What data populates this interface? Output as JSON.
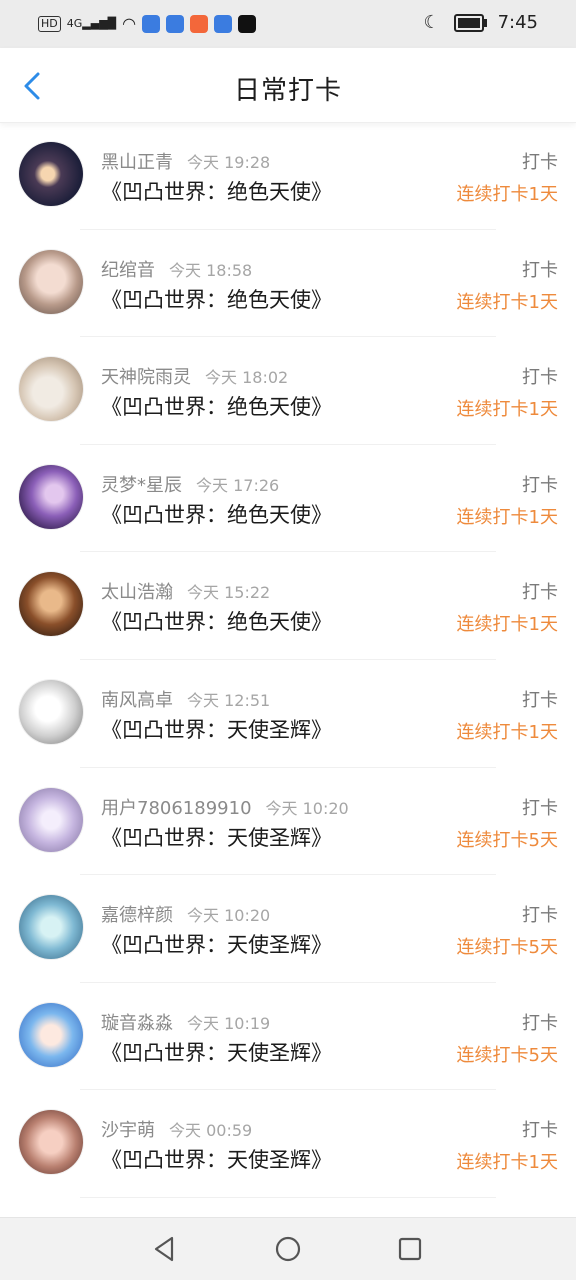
{
  "status_bar": {
    "time": "7:45",
    "left_icons": [
      "hd-icon",
      "signal-4g-icon",
      "wifi-icon",
      "app-paw-icon",
      "app-paw-icon",
      "app-orange-icon",
      "app-paw-icon",
      "app-bird-icon"
    ],
    "right_icons": [
      "moon-icon",
      "battery-icon"
    ]
  },
  "header": {
    "title": "日常打卡",
    "back_icon": "chevron-left-icon",
    "accent": "#2d8ce8"
  },
  "colors": {
    "streak": "#ee8a3c",
    "name": "#8a8a8a",
    "book": "#1c1c1c"
  },
  "checkins": [
    {
      "name": "黑山正青",
      "time": "今天 19:28",
      "book": "《凹凸世界：绝色天使》",
      "action": "打卡",
      "streak": "连续打卡1天"
    },
    {
      "name": "纪绾音",
      "time": "今天 18:58",
      "book": "《凹凸世界：绝色天使》",
      "action": "打卡",
      "streak": "连续打卡1天"
    },
    {
      "name": "天神院雨灵",
      "time": "今天 18:02",
      "book": "《凹凸世界：绝色天使》",
      "action": "打卡",
      "streak": "连续打卡1天"
    },
    {
      "name": "灵梦*星辰",
      "time": "今天 17:26",
      "book": "《凹凸世界：绝色天使》",
      "action": "打卡",
      "streak": "连续打卡1天"
    },
    {
      "name": "太山浩瀚",
      "time": "今天 15:22",
      "book": "《凹凸世界：绝色天使》",
      "action": "打卡",
      "streak": "连续打卡1天"
    },
    {
      "name": "南风高卓",
      "time": "今天 12:51",
      "book": "《凹凸世界：天使圣辉》",
      "action": "打卡",
      "streak": "连续打卡1天"
    },
    {
      "name": "用户7806189910",
      "time": "今天 10:20",
      "book": "《凹凸世界：天使圣辉》",
      "action": "打卡",
      "streak": "连续打卡5天"
    },
    {
      "name": "嘉德梓颜",
      "time": "今天 10:20",
      "book": "《凹凸世界：天使圣辉》",
      "action": "打卡",
      "streak": "连续打卡5天"
    },
    {
      "name": "璇音淼淼",
      "time": "今天 10:19",
      "book": "《凹凸世界：天使圣辉》",
      "action": "打卡",
      "streak": "连续打卡5天"
    },
    {
      "name": "沙宇萌",
      "time": "今天 00:59",
      "book": "《凹凸世界：天使圣辉》",
      "action": "打卡",
      "streak": "连续打卡1天"
    }
  ],
  "nav_bar": [
    "back-triangle-icon",
    "home-circle-icon",
    "recents-square-icon"
  ]
}
